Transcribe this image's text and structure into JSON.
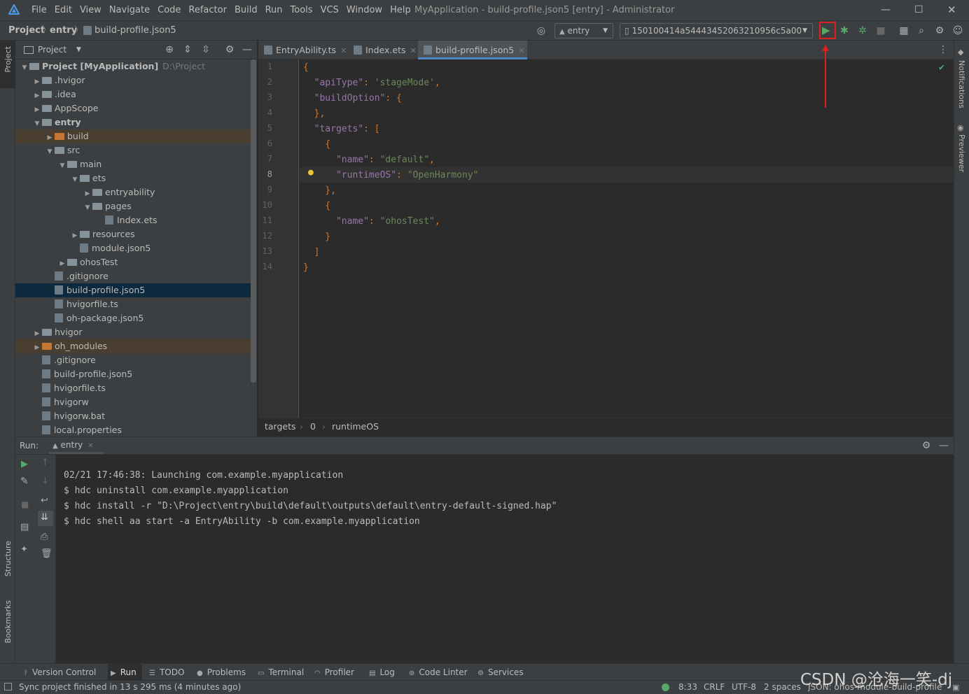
{
  "menu": [
    "File",
    "Edit",
    "View",
    "Navigate",
    "Code",
    "Refactor",
    "Build",
    "Run",
    "Tools",
    "VCS",
    "Window",
    "Help"
  ],
  "window_title": "MyApplication - build-profile.json5 [entry] - Administrator",
  "breadcrumb": {
    "project": "Project",
    "module": "entry",
    "file": "build-profile.json5"
  },
  "toolbar": {
    "module_select": "entry",
    "device_select": "150100414a54443452063210956c5a00"
  },
  "project_panel": {
    "title": "Project"
  },
  "tree": [
    {
      "label": "Project [MyApplication]",
      "suffix": "D:\\Project",
      "depth": 0,
      "arrow": "v",
      "icon": "folder",
      "bold": true
    },
    {
      "label": ".hvigor",
      "depth": 1,
      "arrow": ">",
      "icon": "folder"
    },
    {
      "label": ".idea",
      "depth": 1,
      "arrow": ">",
      "icon": "folder"
    },
    {
      "label": "AppScope",
      "depth": 1,
      "arrow": ">",
      "icon": "folder"
    },
    {
      "label": "entry",
      "depth": 1,
      "arrow": "v",
      "icon": "folder",
      "bold": true
    },
    {
      "label": "build",
      "depth": 2,
      "arrow": ">",
      "icon": "folder-orange",
      "style": "excl"
    },
    {
      "label": "src",
      "depth": 2,
      "arrow": "v",
      "icon": "folder"
    },
    {
      "label": "main",
      "depth": 3,
      "arrow": "v",
      "icon": "folder"
    },
    {
      "label": "ets",
      "depth": 4,
      "arrow": "v",
      "icon": "folder"
    },
    {
      "label": "entryability",
      "depth": 5,
      "arrow": ">",
      "icon": "folder"
    },
    {
      "label": "pages",
      "depth": 5,
      "arrow": "v",
      "icon": "folder"
    },
    {
      "label": "Index.ets",
      "depth": 6,
      "arrow": "",
      "icon": "file"
    },
    {
      "label": "resources",
      "depth": 4,
      "arrow": ">",
      "icon": "folder"
    },
    {
      "label": "module.json5",
      "depth": 4,
      "arrow": "",
      "icon": "file"
    },
    {
      "label": "ohosTest",
      "depth": 3,
      "arrow": ">",
      "icon": "folder"
    },
    {
      "label": ".gitignore",
      "depth": 2,
      "arrow": "",
      "icon": "file"
    },
    {
      "label": "build-profile.json5",
      "depth": 2,
      "arrow": "",
      "icon": "file",
      "style": "sel"
    },
    {
      "label": "hvigorfile.ts",
      "depth": 2,
      "arrow": "",
      "icon": "file"
    },
    {
      "label": "oh-package.json5",
      "depth": 2,
      "arrow": "",
      "icon": "file"
    },
    {
      "label": "hvigor",
      "depth": 1,
      "arrow": ">",
      "icon": "folder"
    },
    {
      "label": "oh_modules",
      "depth": 1,
      "arrow": ">",
      "icon": "folder-orange",
      "style": "excl"
    },
    {
      "label": ".gitignore",
      "depth": 1,
      "arrow": "",
      "icon": "file"
    },
    {
      "label": "build-profile.json5",
      "depth": 1,
      "arrow": "",
      "icon": "file"
    },
    {
      "label": "hvigorfile.ts",
      "depth": 1,
      "arrow": "",
      "icon": "file"
    },
    {
      "label": "hvigorw",
      "depth": 1,
      "arrow": "",
      "icon": "file"
    },
    {
      "label": "hvigorw.bat",
      "depth": 1,
      "arrow": "",
      "icon": "file"
    },
    {
      "label": "local.properties",
      "depth": 1,
      "arrow": "",
      "icon": "file"
    }
  ],
  "editor_tabs": [
    {
      "label": "EntryAbility.ts",
      "active": false
    },
    {
      "label": "Index.ets",
      "active": false
    },
    {
      "label": "build-profile.json5",
      "active": true
    }
  ],
  "code_lines": [
    [
      [
        "p",
        "{"
      ]
    ],
    [
      [
        "k",
        "  \"apiType\""
      ],
      [
        "p",
        ": "
      ],
      [
        "s",
        "'stageMode'"
      ],
      [
        "p",
        ","
      ]
    ],
    [
      [
        "k",
        "  \"buildOption\""
      ],
      [
        "p",
        ": {"
      ]
    ],
    [
      [
        "p",
        "  },"
      ]
    ],
    [
      [
        "k",
        "  \"targets\""
      ],
      [
        "p",
        ": ["
      ]
    ],
    [
      [
        "p",
        "    {"
      ]
    ],
    [
      [
        "k",
        "      \"name\""
      ],
      [
        "p",
        ": "
      ],
      [
        "s",
        "\"default\""
      ],
      [
        "p",
        ","
      ]
    ],
    [
      [
        "k",
        "      \"runtimeOS\""
      ],
      [
        "p",
        ": "
      ],
      [
        "s",
        "\"OpenHarmony\""
      ]
    ],
    [
      [
        "p",
        "    },"
      ]
    ],
    [
      [
        "p",
        "    {"
      ]
    ],
    [
      [
        "k",
        "      \"name\""
      ],
      [
        "p",
        ": "
      ],
      [
        "s",
        "\"ohosTest\""
      ],
      [
        "p",
        ","
      ]
    ],
    [
      [
        "p",
        "    }"
      ]
    ],
    [
      [
        "p",
        "  ]"
      ]
    ],
    [
      [
        "p",
        "}"
      ]
    ]
  ],
  "line_numbers": [
    "1",
    "2",
    "3",
    "4",
    "5",
    "6",
    "7",
    "8",
    "9",
    "10",
    "11",
    "12",
    "13",
    "14"
  ],
  "editor_breadcrumb": [
    "targets",
    "0",
    "runtimeOS"
  ],
  "right_strip": {
    "notifications": "Notifications",
    "previewer": "Previewer"
  },
  "left_strip": {
    "project": "Project",
    "structure": "Structure",
    "bookmarks": "Bookmarks"
  },
  "run_panel": {
    "label": "Run:",
    "tab": "entry"
  },
  "console_lines": [
    "02/21 17:46:38: Launching com.example.myapplication",
    "$ hdc uninstall com.example.myapplication",
    "$ hdc install -r \"D:\\Project\\entry\\build\\default\\outputs\\default\\entry-default-signed.hap\"",
    "$ hdc shell aa start -a EntryAbility -b com.example.myapplication"
  ],
  "bottom_tabs": [
    "Version Control",
    "Run",
    "TODO",
    "Problems",
    "Terminal",
    "Profiler",
    "Log",
    "Code Linter",
    "Services"
  ],
  "status": {
    "message": "Sync project finished in 13 s 295 ms (4 minutes ago)",
    "position": "8:33",
    "line_sep": "CRLF",
    "encoding": "UTF-8",
    "indent": "2 spaces",
    "schema": "JSON: ohos-module-build-profile"
  },
  "watermark": "CSDN @沧海一笑-dj",
  "colors": {
    "run_highlight": "#e0201e",
    "run_green": "#59a869",
    "selection": "#0d293e"
  }
}
